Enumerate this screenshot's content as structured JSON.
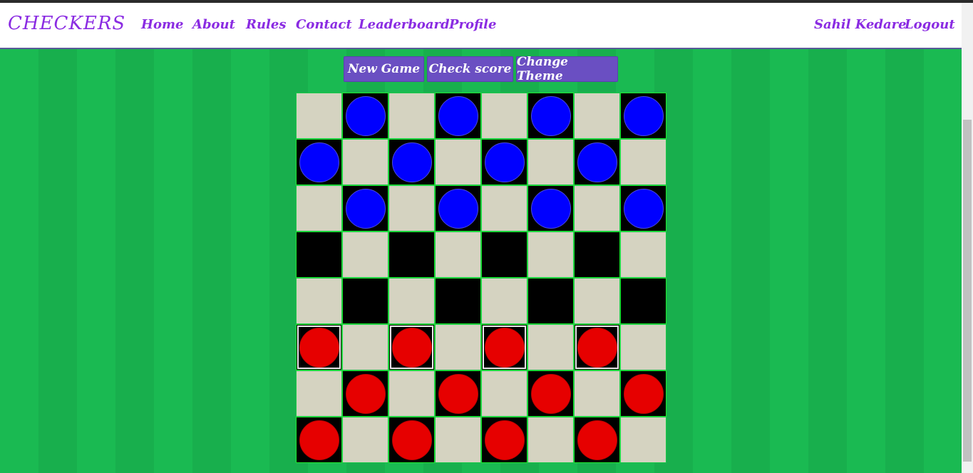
{
  "nav": {
    "brand": "CHECKERS",
    "links": [
      "Home",
      "About",
      "Rules",
      "Contact",
      "Leaderboard",
      "Profile"
    ],
    "user": "Sahil Kedare",
    "logout": "Logout"
  },
  "actions": {
    "new_game": "New Game",
    "check_score": "Check score",
    "change_theme": "Change Theme"
  },
  "colors": {
    "background": "#1aba52",
    "accent": "#8a2be2",
    "button": "#6a4fc2",
    "light_square": "#d5d3c1",
    "dark_square": "#000000",
    "blue_piece": "#0000ff",
    "red_piece": "#e60000"
  },
  "board": {
    "rows": [
      [
        null,
        "blue",
        null,
        "blue",
        null,
        "blue",
        null,
        "blue"
      ],
      [
        "blue",
        null,
        "blue",
        null,
        "blue",
        null,
        "blue",
        null
      ],
      [
        null,
        "blue",
        null,
        "blue",
        null,
        "blue",
        null,
        "blue"
      ],
      [
        null,
        null,
        null,
        null,
        null,
        null,
        null,
        null
      ],
      [
        null,
        null,
        null,
        null,
        null,
        null,
        null,
        null
      ],
      [
        "red",
        null,
        "red",
        null,
        "red",
        null,
        "red",
        null
      ],
      [
        null,
        "red",
        null,
        "red",
        null,
        "red",
        null,
        "red"
      ],
      [
        "red",
        null,
        "red",
        null,
        "red",
        null,
        "red",
        null
      ]
    ],
    "movable": [
      [
        5,
        0
      ],
      [
        5,
        2
      ],
      [
        5,
        4
      ],
      [
        5,
        6
      ]
    ]
  }
}
